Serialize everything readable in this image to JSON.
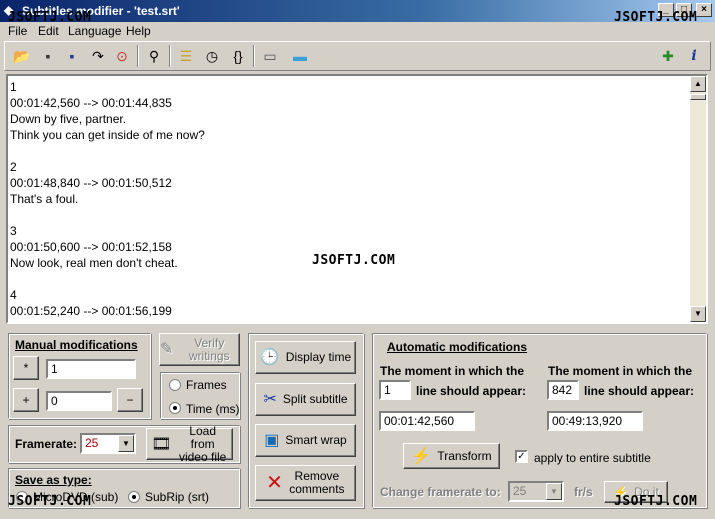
{
  "window": {
    "title": "Subtitles modifier - 'test.srt'",
    "min": "_",
    "max": "□",
    "close": "×"
  },
  "menu": {
    "items": [
      "File",
      "Edit",
      "Language",
      "Help"
    ]
  },
  "editor": {
    "text": "1\n00:01:42,560 --> 00:01:44,835\nDown by five, partner.\nThink you can get inside of me now?\n\n2\n00:01:48,840 --> 00:01:50,512\nThat's a foul.\n\n3\n00:01:50,600 --> 00:01:52,158\nNow look, real men don't cheat.\n\n4\n00:01:52,240 --> 00:01:56,199\nThough if the..."
  },
  "manual": {
    "title": "Manual modifications",
    "mult_value": "1",
    "add_value": "0",
    "mult_symbol": "*",
    "add_symbol": "+",
    "sub_symbol": "−"
  },
  "verify": {
    "label": "Verify writings"
  },
  "unit": {
    "frames": "Frames",
    "time": "Time (ms)"
  },
  "framerate": {
    "label": "Framerate:",
    "value": "25"
  },
  "load_video": {
    "label": "Load from video file"
  },
  "save": {
    "title": "Save as type:",
    "microdvd": "MicroDVD (sub)",
    "subrip": "SubRip (srt)"
  },
  "actions": {
    "display_time": "Display time",
    "split": "Split subtitle",
    "smart_wrap": "Smart wrap",
    "remove_comments": "Remove comments"
  },
  "auto": {
    "title": "Automatic modifications",
    "moment_label_1": "The moment in which the",
    "moment_label_2": "The moment in which the",
    "line_label_1": "line should appear:",
    "line_label_2": "line should appear:",
    "line_num_1": "1",
    "line_num_2": "842",
    "time_1": "00:01:42,560",
    "time_2": "00:49:13,920",
    "transform": "Transform",
    "apply_entire": "apply to entire subtitle",
    "change_framerate": "Change framerate to:",
    "framerate_value": "25",
    "unit": "fr/s",
    "do_it": "Do it"
  },
  "watermark": "JSOFTJ.COM",
  "colors": {
    "title_start": "#0a246a",
    "title_end": "#a6caf0",
    "face": "#d4d0c8",
    "framerate_text": "#a00000"
  }
}
